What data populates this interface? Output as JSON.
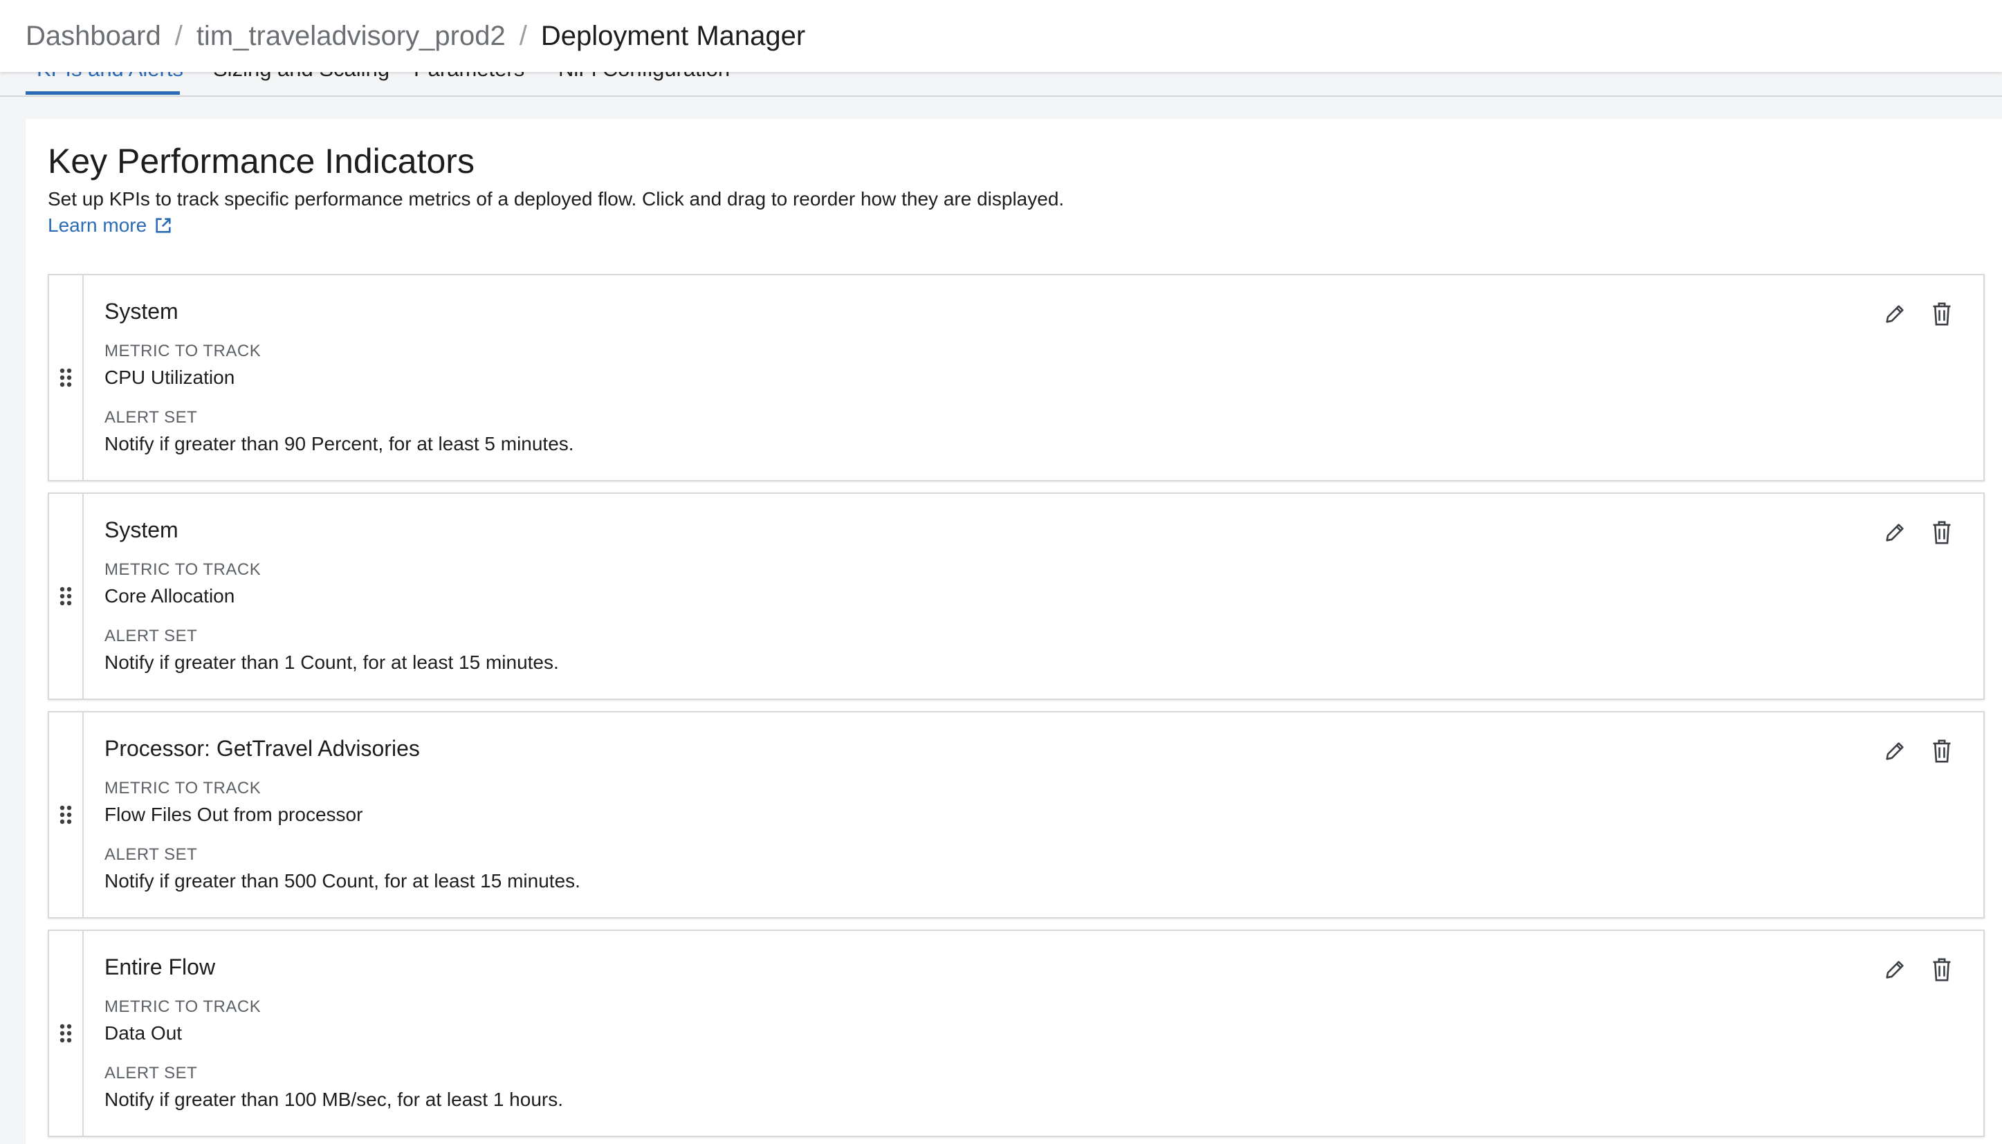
{
  "breadcrumb": {
    "items": [
      "Dashboard",
      "tim_traveladvisory_prod2"
    ],
    "current": "Deployment Manager",
    "separator": "/"
  },
  "tabs": [
    {
      "label": "KPIs and Alerts",
      "active": true
    },
    {
      "label": "Sizing and Scaling",
      "active": false
    },
    {
      "label": "Parameters",
      "active": false
    },
    {
      "label": "NiFi Configuration",
      "active": false
    }
  ],
  "kpi_section": {
    "title": "Key Performance Indicators",
    "description": "Set up KPIs to track specific performance metrics of a deployed flow. Click and drag to reorder how they are displayed.",
    "learn_more": "Learn more"
  },
  "labels": {
    "metric_to_track": "METRIC TO TRACK",
    "alert_set": "ALERT SET"
  },
  "kpis": [
    {
      "scope": "System",
      "metric": "CPU Utilization",
      "alert": "Notify if greater than 90 Percent, for at least 5 minutes."
    },
    {
      "scope": "System",
      "metric": "Core Allocation",
      "alert": "Notify if greater than 1 Count, for at least 15 minutes."
    },
    {
      "scope": "Processor: GetTravel Advisories",
      "metric": "Flow Files Out from processor",
      "alert": "Notify if greater than 500 Count, for at least 15 minutes."
    },
    {
      "scope": "Entire Flow",
      "metric": "Data Out",
      "alert": "Notify if greater than 100 MB/sec, for at least 1 hours."
    }
  ],
  "icons": {
    "drag": "drag-handle-icon",
    "edit": "pencil-icon",
    "delete": "trash-icon",
    "external": "external-link-icon"
  },
  "colors": {
    "accent": "#2a6bb8",
    "text": "#1d1d1d",
    "muted": "#5c6166"
  }
}
